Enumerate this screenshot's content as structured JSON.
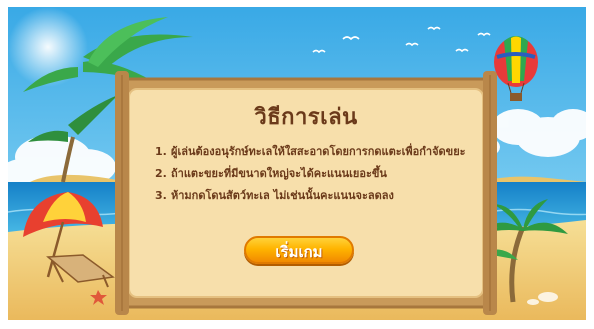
{
  "game": {
    "title": "วิธีการเล่น",
    "rules": [
      {
        "num": "1.",
        "text": "ผู้เล่นต้องอนุรักษ์ทะเลให้ใสสะอาดโดยการกดแตะเพื่อกำจัดขยะ"
      },
      {
        "num": "2.",
        "text": "ถ้าแตะขยะที่มีขนาดใหญ่จะได้คะแนนเยอะขึ้น"
      },
      {
        "num": "3.",
        "text": "ห้ามกดโดนสัตว์ทะเล ไม่เช่นนั้นคะแนนจะลดลง"
      }
    ],
    "start_button": "เริ่มเกม"
  },
  "colors": {
    "sky": "#3fb6e8",
    "sea": "#1e8fd0",
    "sand": "#f3d37e",
    "panel": "#f6dca6",
    "text": "#6b3a1a",
    "button": "#f9a400"
  },
  "icons": [
    "hot-air-balloon-icon",
    "palm-tree-icon",
    "beach-umbrella-icon",
    "beach-chair-icon",
    "starfish-icon",
    "seagull-icon",
    "sun-icon"
  ]
}
